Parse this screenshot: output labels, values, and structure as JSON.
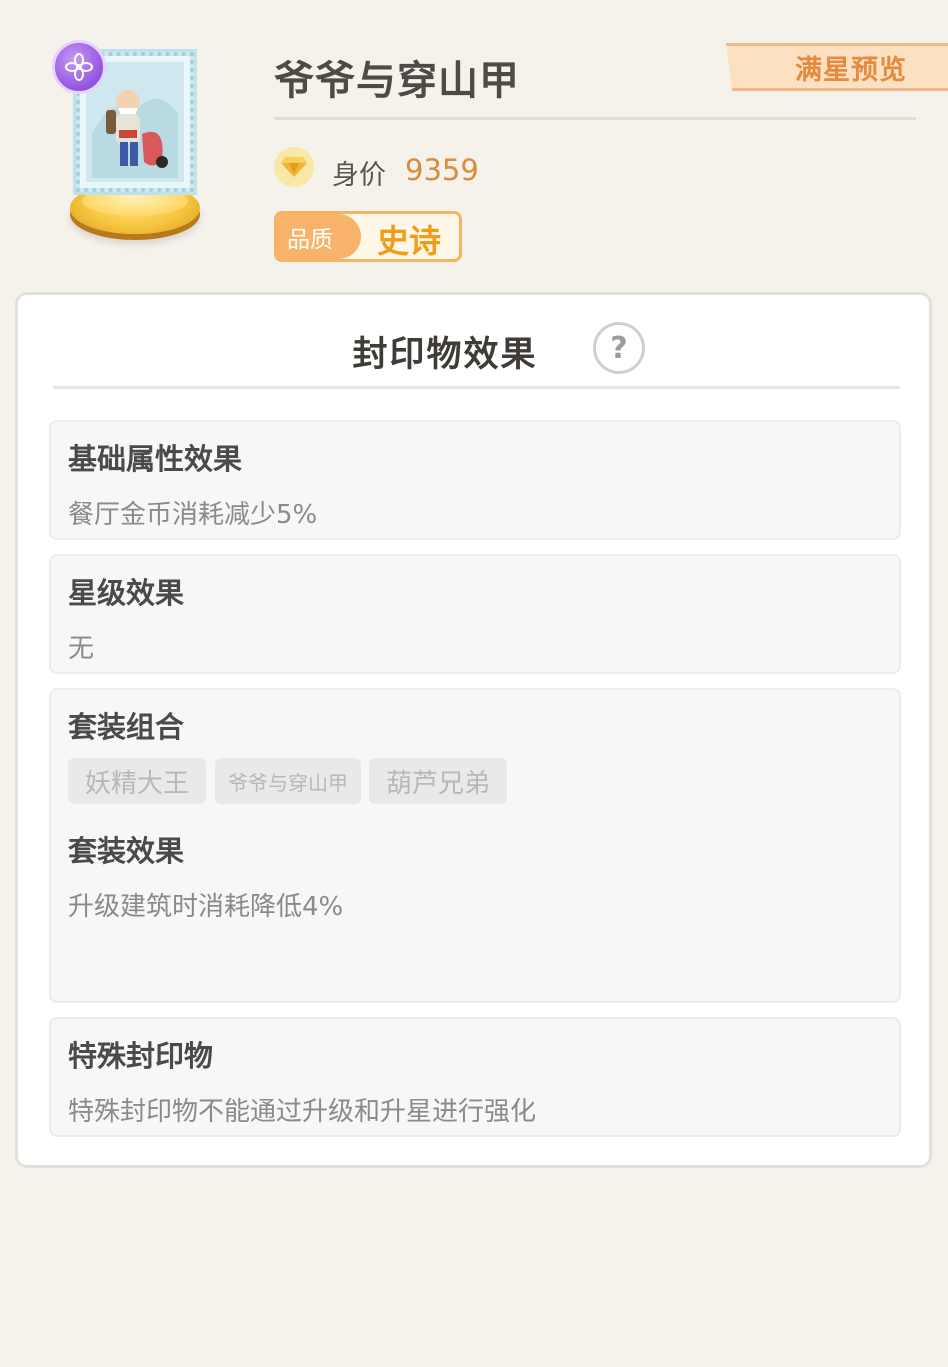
{
  "item": {
    "title": "爷爷与穿山甲",
    "icon": "grandpa-pangolin-stamp",
    "rarity_badge_icon": "purple-flower-badge"
  },
  "header": {
    "preview_button": "满星预览",
    "price_label": "身价",
    "price_value": "9359",
    "price_icon": "gem-icon",
    "quality_label": "品质",
    "quality_value": "史诗"
  },
  "panel": {
    "title": "封印物效果",
    "help_symbol": "?",
    "sections": {
      "base": {
        "title": "基础属性效果",
        "text": "餐厅金币消耗减少5%"
      },
      "star": {
        "title": "星级效果",
        "text": "无"
      },
      "set": {
        "title": "套装组合",
        "chips": [
          "妖精大王",
          "爷爷与穿山甲",
          "葫芦兄弟"
        ],
        "effect_title": "套装效果",
        "effect_text": "升级建筑时消耗降低4%"
      },
      "special": {
        "title": "特殊封印物",
        "text": "特殊封印物不能通过升级和升星进行强化"
      }
    }
  },
  "colors": {
    "background": "#f4f2ea",
    "accent_orange": "#e58b3f",
    "quality_epic": "#f29b16",
    "price": "#d98d3c"
  }
}
